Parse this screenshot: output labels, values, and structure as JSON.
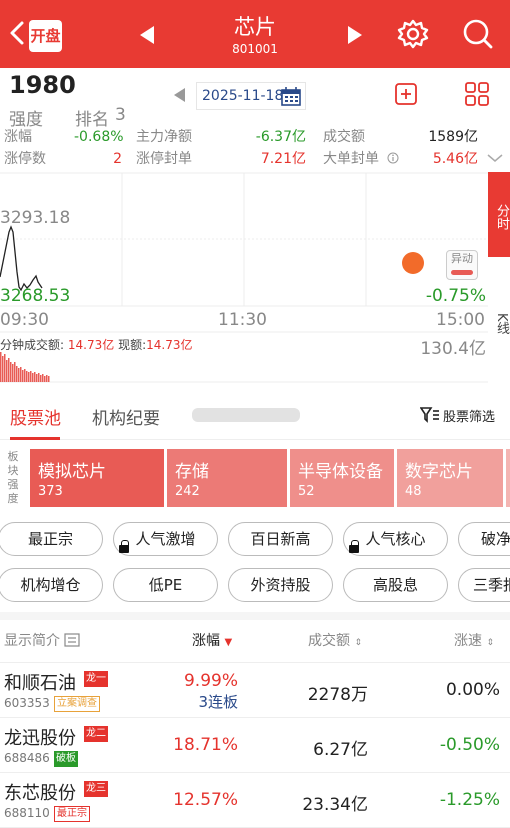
{
  "header": {
    "kaipan_label": "开盘",
    "title": "芯片",
    "code": "801001"
  },
  "summary": {
    "strength_value": "1980",
    "strength_label": "强度",
    "rank_label": "排名",
    "rank_value": "3",
    "date": "2025-11-18",
    "stats": [
      {
        "label": "涨幅",
        "value": "-0.68%",
        "color": "#2a9a2a"
      },
      {
        "label": "主力净额",
        "value": "-6.37亿",
        "color": "#2a9a2a"
      },
      {
        "label": "成交额",
        "value": "1589亿",
        "color": "#222222"
      },
      {
        "label": "涨停数",
        "value": "2",
        "color": "#e5332d"
      },
      {
        "label": "涨停封单",
        "value": "7.21亿",
        "color": "#e5332d"
      },
      {
        "label": "大单封单",
        "value": "5.46亿",
        "color": "#e5332d"
      }
    ]
  },
  "chart": {
    "price_high": "3293.18",
    "price_low": "3268.53",
    "change": "-0.75%",
    "time_start": "09:30",
    "time_mid": "11:30",
    "time_end": "15:00",
    "minute_volume_label": "分钟成交额:",
    "minute_volume_value": "14.73亿",
    "current_label": "现额:",
    "current_value": "14.73亿",
    "volume_max": "130.4亿",
    "yidong_label": "异动",
    "side_tab_fenshi": "分时",
    "side_tab_kline": "K线"
  },
  "tabs": [
    "股票池",
    "机构纪要"
  ],
  "filter_label": "股票筛选",
  "strength_side_label": "板块强度",
  "sectors": [
    {
      "name": "模拟芯片",
      "count": "373",
      "color": "#e85b55"
    },
    {
      "name": "存储",
      "count": "242",
      "color": "#ec7a76"
    },
    {
      "name": "半导体设备",
      "count": "52",
      "color": "#ef8f8b"
    },
    {
      "name": "数字芯片",
      "count": "48",
      "color": "#f1a09c"
    },
    {
      "name": "",
      "count": "",
      "color": "#f4b5b2"
    }
  ],
  "pills_row1": [
    "最正宗",
    "人气激增",
    "百日新高",
    "人气核心",
    "破净"
  ],
  "pills_row2": [
    "机构增仓",
    "低PE",
    "外资持股",
    "高股息",
    "三季报"
  ],
  "table": {
    "col_name": "显示简介",
    "col_change": "涨幅",
    "col_amount": "成交额",
    "col_speed": "涨速",
    "rows": [
      {
        "name": "和顺石油",
        "code": "603353",
        "tag": "立案调查",
        "dragon": "龙一",
        "change": "9.99%",
        "sub": "3连板",
        "amount": "2278万",
        "speed": "0.00%",
        "speed_color": "#222222"
      },
      {
        "name": "龙迅股份",
        "code": "688486",
        "tag": "破板",
        "dragon": "龙二",
        "change": "18.71%",
        "sub": "",
        "amount": "6.27亿",
        "speed": "-0.50%",
        "speed_color": "#2a9a2a"
      },
      {
        "name": "东芯股份",
        "code": "688110",
        "tag": "最正宗",
        "dragon": "龙三",
        "change": "12.57%",
        "sub": "",
        "amount": "23.34亿",
        "speed": "-1.25%",
        "speed_color": "#2a9a2a"
      }
    ]
  }
}
